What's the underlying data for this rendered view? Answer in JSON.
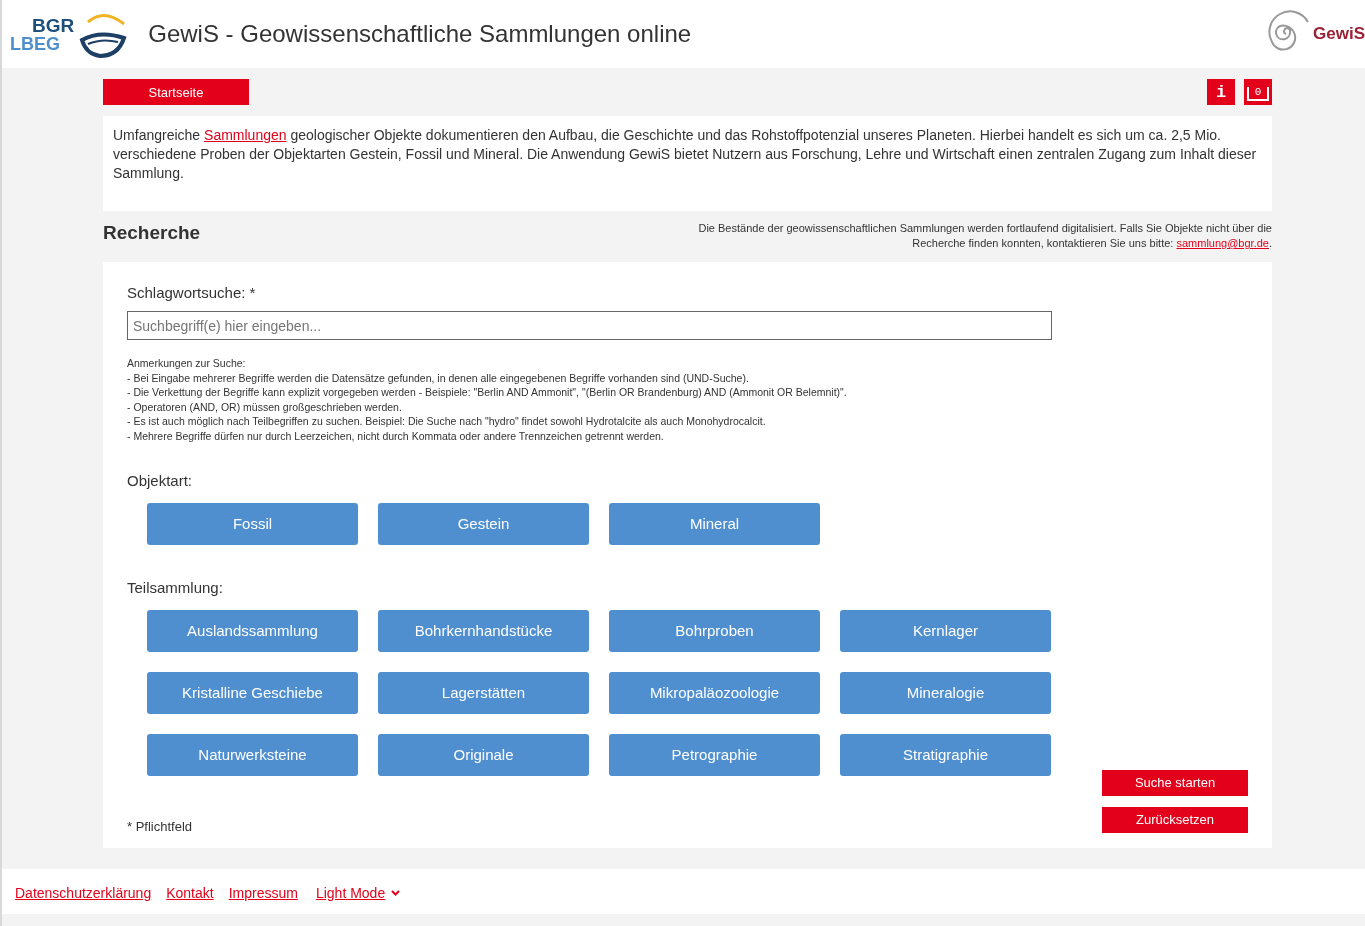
{
  "header": {
    "logo_top": "BGR",
    "logo_bottom": "LBEG",
    "title": "GewiS - Geowissenschaftliche Sammlungen online",
    "brand": "GewiS"
  },
  "nav": {
    "home": "Startseite",
    "info": "i",
    "cart_count": "0"
  },
  "intro": {
    "before": "Umfangreiche ",
    "link": "Sammlungen",
    "after": " geologischer Objekte dokumentieren den Aufbau, die Geschichte und das Rohstoffpotenzial unseres Planeten. Hierbei handelt es sich um ca. 2,5 Mio. verschiedene Proben der Objektarten Gestein, Fossil und Mineral. Die Anwendung GewiS bietet Nutzern aus Forschung, Lehre und Wirtschaft einen zentralen Zugang zum Inhalt dieser Sammlung."
  },
  "research": {
    "heading": "Recherche",
    "notice_before": "Die Bestände der geowissenschaftlichen Sammlungen werden fortlaufend digitalisiert. Falls Sie Objekte nicht über die Recherche finden konnten, kontaktieren Sie uns bitte: ",
    "notice_link": "sammlung@bgr.de",
    "notice_after": "."
  },
  "search": {
    "label": "Schlagwortsuche: *",
    "placeholder": "Suchbegriff(e) hier eingeben...",
    "notes": [
      "Anmerkungen zur Suche:",
      "- Bei Eingabe mehrerer Begriffe werden die Datensätze gefunden, in denen alle eingegebenen Begriffe vorhanden sind (UND-Suche).",
      "- Die Verkettung der Begriffe kann explizit vorgegeben werden - Beispiele: \"Berlin AND Ammonit\", \"(Berlin OR Brandenburg) AND (Ammonit OR Belemnit)\".",
      "- Operatoren (AND, OR) müssen großgeschrieben werden.",
      "- Es ist auch möglich nach Teilbegriffen zu suchen. Beispiel: Die Suche nach \"hydro\" findet sowohl Hydrotalcite als auch Monohydrocalcit.",
      "- Mehrere Begriffe dürfen nur durch Leerzeichen, nicht durch Kommata oder andere Trennzeichen getrennt werden."
    ]
  },
  "object_types": {
    "label": "Objektart:",
    "buttons": [
      "Fossil",
      "Gestein",
      "Mineral"
    ]
  },
  "subcollections": {
    "label": "Teilsammlung:",
    "buttons": [
      "Auslandssammlung",
      "Bohrkernhandstücke",
      "Bohrproben",
      "Kernlager",
      "Kristalline Geschiebe",
      "Lagerstätten",
      "Mikropaläozoologie",
      "Mineralogie",
      "Naturwerksteine",
      "Originale",
      "Petrographie",
      "Stratigraphie"
    ]
  },
  "actions": [
    "Suche starten",
    "Zurücksetzen"
  ],
  "required_note": "* Pflichtfeld",
  "footer": {
    "links": [
      "Datenschutzerklärung",
      "Kontakt",
      "Impressum"
    ],
    "theme": "Light Mode"
  }
}
